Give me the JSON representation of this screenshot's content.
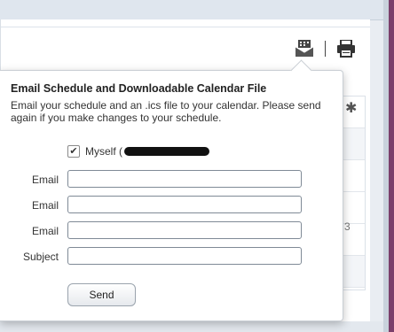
{
  "toolbar": {
    "email_icon": "email-calendar-icon",
    "print_icon": "printer-icon"
  },
  "background": {
    "table_cell_value": "3",
    "gear_icon": "gear-icon"
  },
  "popover": {
    "title": "Email Schedule and Downloadable Calendar File",
    "description": "Email your schedule and an .ics file to your calendar. Please send again if you make changes to your schedule.",
    "myself_label": "Myself (",
    "myself_checked": true,
    "fields": [
      {
        "label": "Email",
        "value": "",
        "placeholder": ""
      },
      {
        "label": "Email",
        "value": "",
        "placeholder": ""
      },
      {
        "label": "Email",
        "value": "",
        "placeholder": ""
      },
      {
        "label": "Subject",
        "value": "",
        "placeholder": ""
      }
    ],
    "send_label": "Send"
  },
  "colors": {
    "accent_edge": "#7b3f6b",
    "panel_bg": "#ffffff",
    "page_bg": "#e9edf2"
  }
}
